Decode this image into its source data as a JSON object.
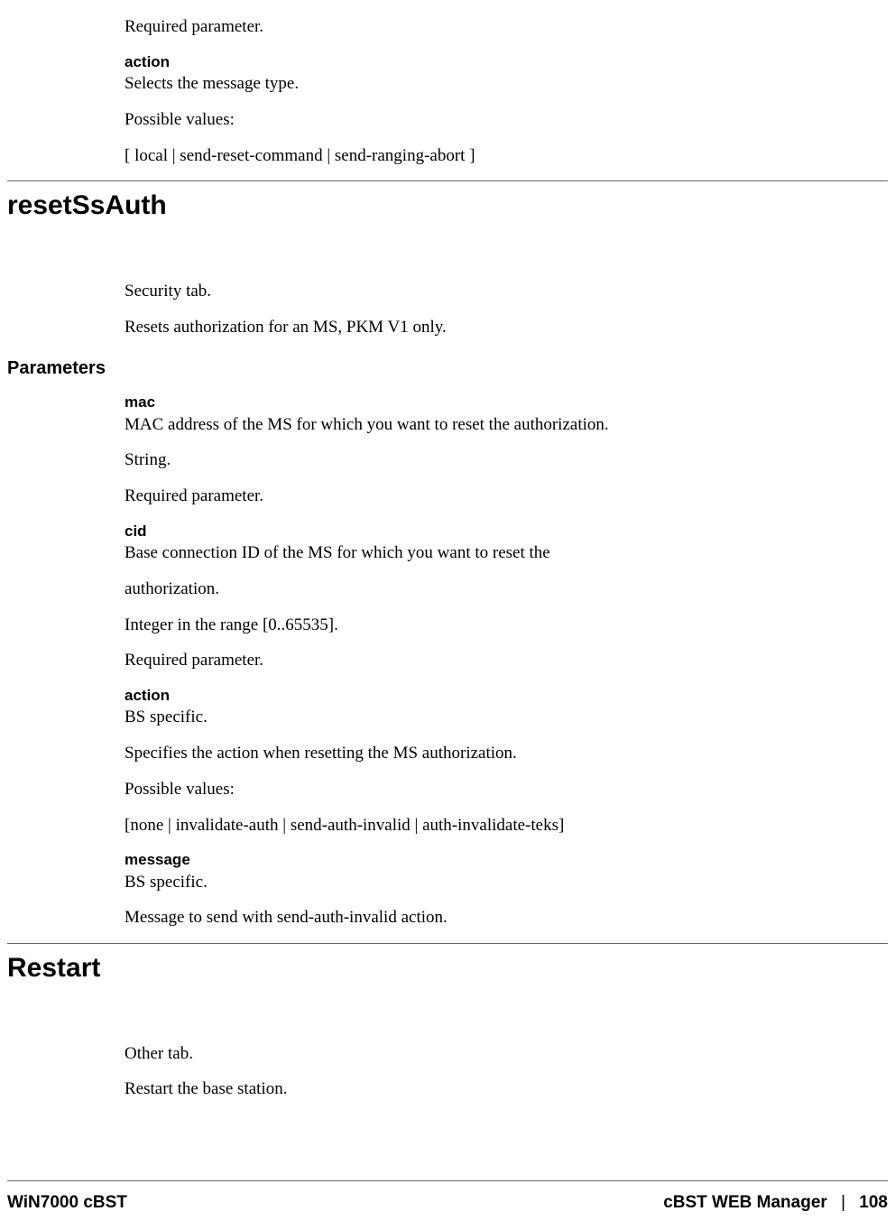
{
  "top": {
    "required": "Required parameter.",
    "action_name": "action",
    "action_desc": "Selects the message type.",
    "possible_values_label": "Possible values:",
    "possible_values": "[ local | send-reset-command | send-ranging-abort ]"
  },
  "section_reset": {
    "heading": "resetSsAuth",
    "intro1": "Security tab.",
    "intro2": "Resets authorization for an MS, PKM V1 only.",
    "parameters_heading": "Parameters",
    "params": {
      "mac": {
        "name": "mac",
        "desc": "MAC address of the MS for which you want to reset the authorization.",
        "type": "String.",
        "required": "Required parameter."
      },
      "cid": {
        "name": "cid",
        "desc1": "Base connection ID of the MS for which you want to reset the",
        "desc2": "authorization.",
        "type": "Integer in the range [0..65535].",
        "required": "Required parameter."
      },
      "action": {
        "name": "action",
        "desc1": "BS specific.",
        "desc2": "Specifies the action when resetting the MS authorization.",
        "possible_values_label": "Possible values:",
        "possible_values": "[none | invalidate-auth | send-auth-invalid | auth-invalidate-teks]"
      },
      "message": {
        "name": "message",
        "desc1": "BS specific.",
        "desc2": "Message to send with send-auth-invalid action."
      }
    }
  },
  "section_restart": {
    "heading": "Restart",
    "intro1": "Other tab.",
    "intro2": "Restart the base station."
  },
  "footer": {
    "left": "WiN7000 cBST",
    "right_title": "cBST WEB Manager",
    "sep": "|",
    "page": "108"
  }
}
